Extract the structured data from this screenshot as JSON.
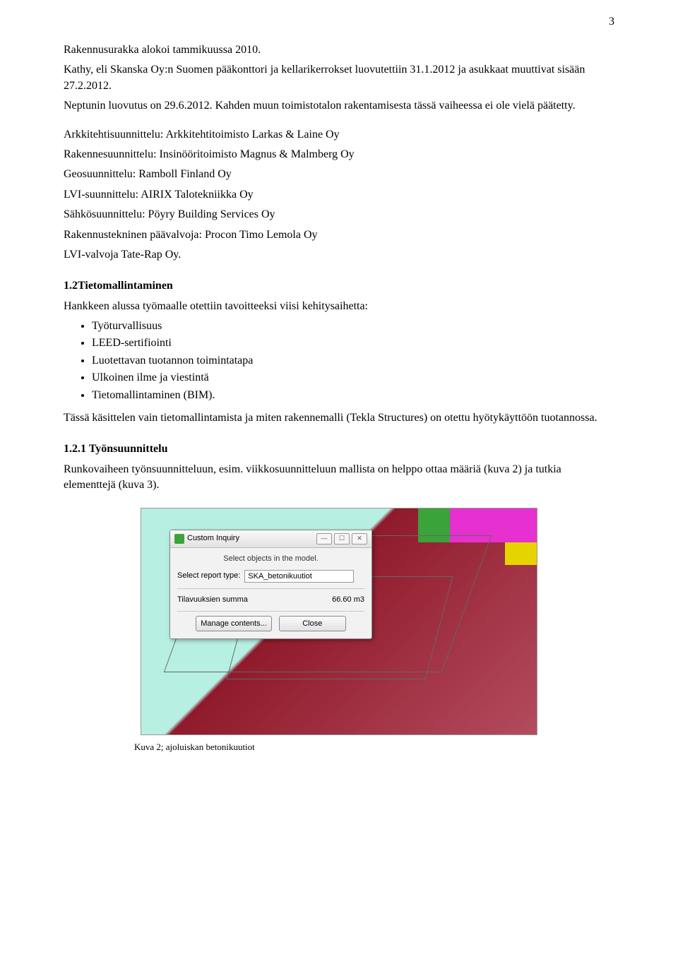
{
  "page_number": "3",
  "p1": "Rakennusurakka alokoi tammikuussa 2010.",
  "p2": "Kathy, eli Skanska Oy:n Suomen pääkonttori ja kellarikerrokset luovutettiin 31.1.2012 ja asukkaat muuttivat sisään 27.2.2012.",
  "p3": "Neptunin luovutus on 29.6.2012. Kahden muun toimistotalon rakentamisesta tässä vaiheessa ei ole vielä päätetty.",
  "credits": [
    "Arkkitehtisuunnittelu: Arkkitehtitoimisto Larkas & Laine Oy",
    "Rakennesuunnittelu: Insinööritoimisto Magnus & Malmberg Oy",
    "Geosuunnittelu: Ramboll Finland Oy",
    "LVI-suunnittelu: AIRIX Talotekniikka Oy",
    "Sähkösuunnittelu: Pöyry Building Services Oy",
    "Rakennustekninen päävalvoja: Procon Timo Lemola Oy",
    "LVI-valvoja Tate-Rap Oy."
  ],
  "h1": "1.2Tietomallintaminen",
  "intro_list_lead": "Hankkeen alussa työmaalle otettiin tavoitteeksi viisi kehitysaihetta:",
  "bullets": [
    "Työturvallisuus",
    "LEED-sertifiointi",
    "Luotettavan tuotannon toimintatapa",
    "Ulkoinen ilme ja viestintä",
    "Tietomallintaminen (BIM)."
  ],
  "p4": "Tässä käsittelen vain tietomallintamista ja miten rakennemalli (Tekla Structures) on otettu hyötykäyttöön tuotannossa.",
  "h2": "1.2.1  Työnsuunnittelu",
  "p5": "Runkovaiheen työnsuunnitteluun, esim. viikkosuunnitteluun mallista on helppo ottaa määriä (kuva 2) ja tutkia elementtejä (kuva 3).",
  "dialog": {
    "title": "Custom Inquiry",
    "instruction": "Select objects in the model.",
    "report_label": "Select report type:",
    "report_value": "SKA_betonikuutiot",
    "result_label": "Tilavuuksien summa",
    "result_value": "66.60 m3",
    "btn_manage": "Manage contents...",
    "btn_close": "Close",
    "win_min": "—",
    "win_max": "☐",
    "win_close": "✕"
  },
  "caption": "Kuva 2; ajoluiskan betonikuutiot"
}
